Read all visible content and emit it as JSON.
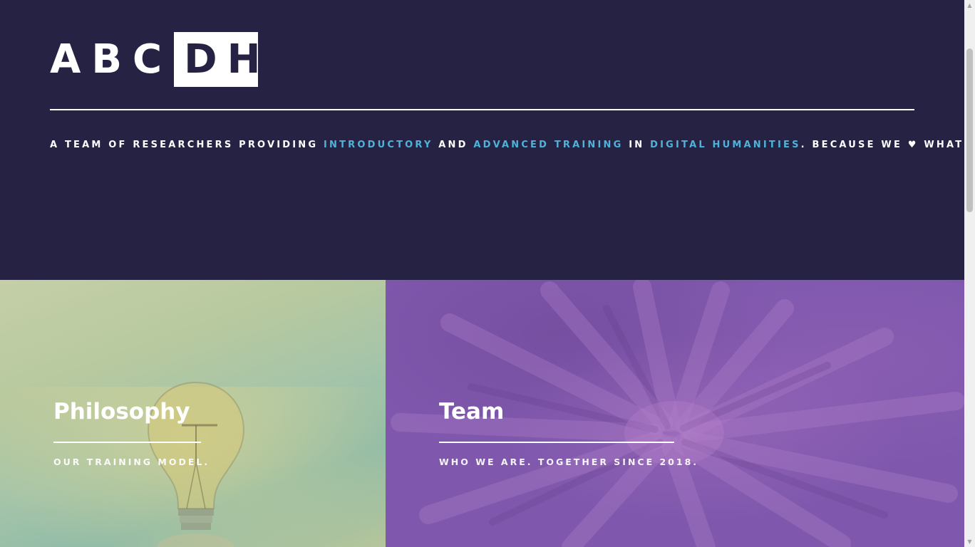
{
  "header": {
    "logo_plain": "ABC",
    "logo_boxed": "DH",
    "tagline": {
      "part1": "A TEAM OF RESEARCHERS PROVIDING ",
      "link1": "INTRODUCTORY",
      "part2": " AND ",
      "link2": "ADVANCED TRAINING",
      "part3": " IN ",
      "link3": "DIGITAL HUMANITIES",
      "part4": ". BECAUSE WE ",
      "heart": "♥",
      "part5": " WHAT WE DO."
    }
  },
  "panels": [
    {
      "title": "Philosophy",
      "subtitle": "OUR TRAINING MODEL.",
      "image": "lightbulb-image"
    },
    {
      "title": "Team",
      "subtitle": "WHO WE ARE. TOGETHER SINCE 2018.",
      "image": "hands-together-image"
    }
  ],
  "colors": {
    "header_bg": "#262244",
    "accent": "#4fb3d9",
    "team_overlay": "#7f58ad",
    "philosophy_overlay": "#b8c99f"
  },
  "scrollbar": {
    "up_icon": "▲",
    "down_icon": "▼"
  }
}
